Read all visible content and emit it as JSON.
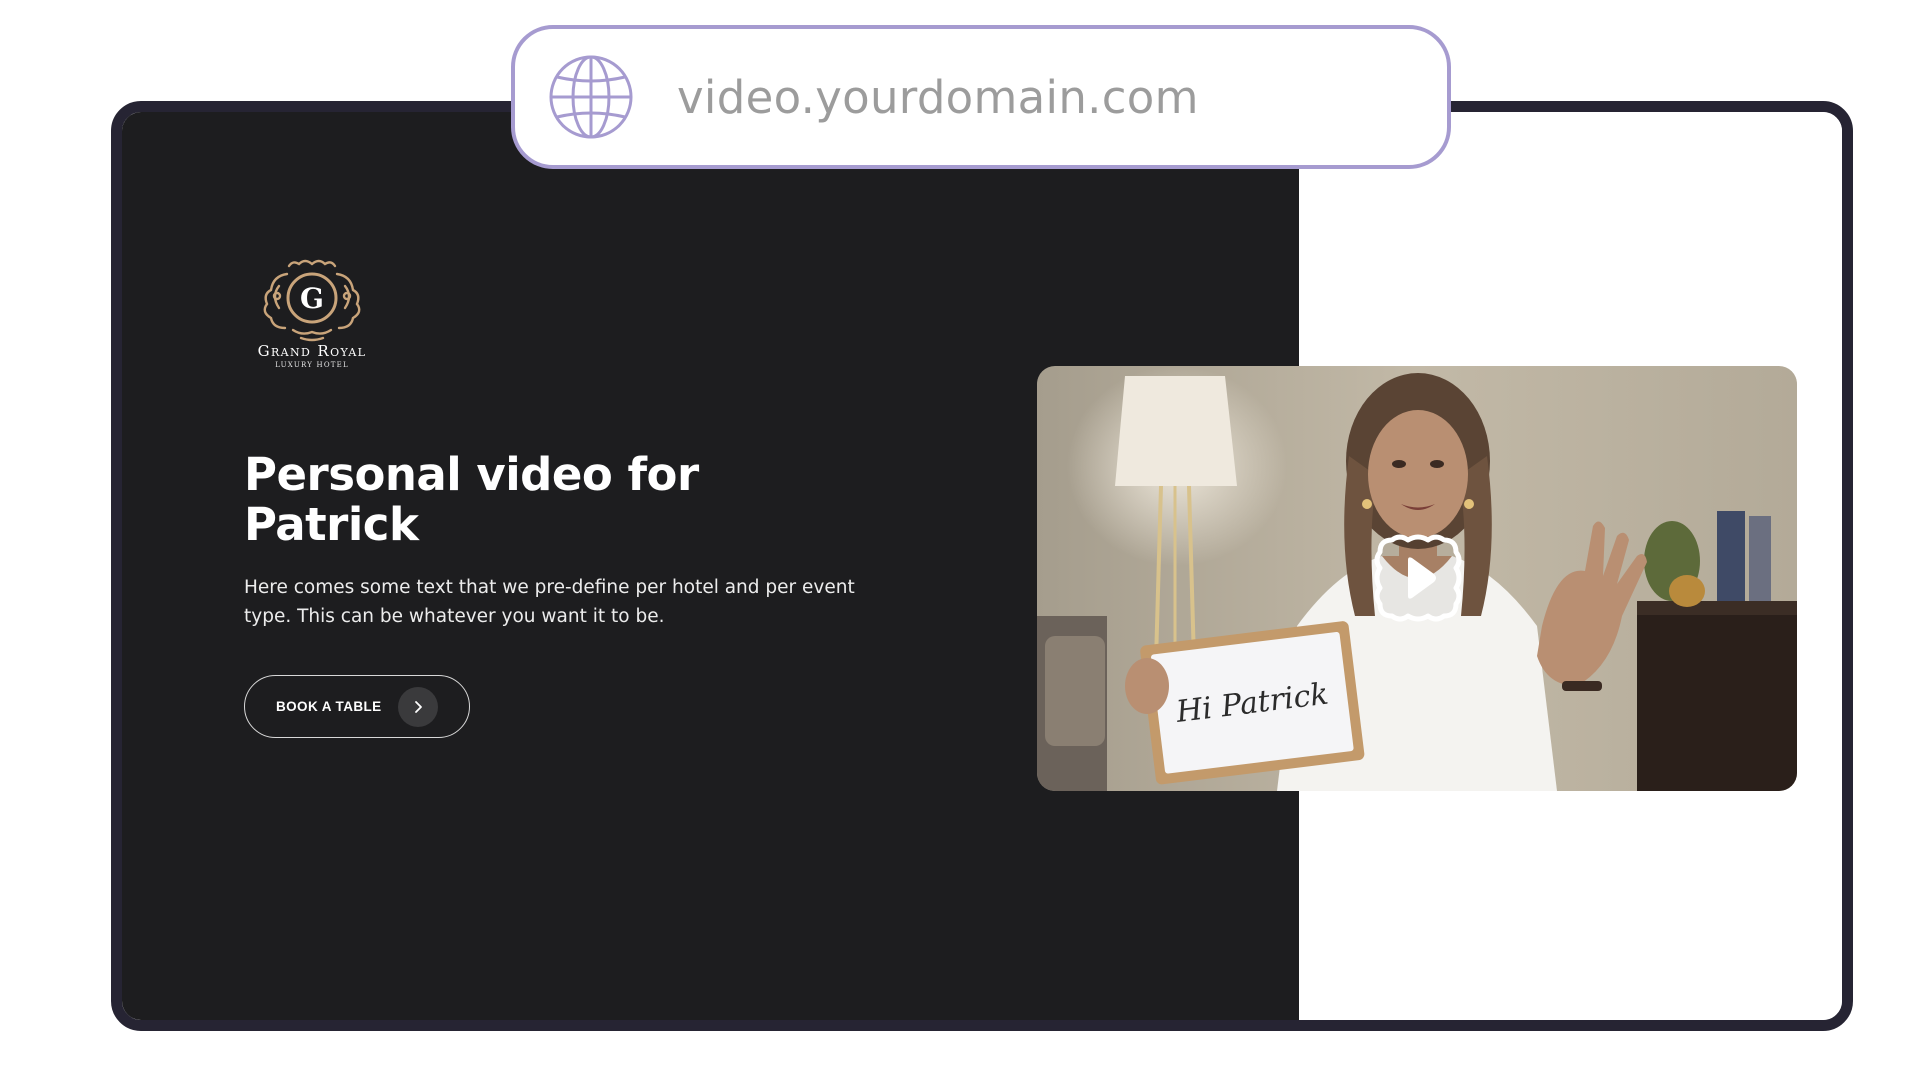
{
  "browser": {
    "url": "video.yourdomain.com",
    "url_icon": "globe-icon"
  },
  "hotel": {
    "logo_letter": "G",
    "name": "Grand Royal",
    "subtitle": "LUXURY HOTEL",
    "brand_color": "#c9a47a"
  },
  "hero": {
    "title_line1": "Personal video for",
    "title_line2": "Patrick",
    "description": "Here comes some text that we pre-define per hotel and per event type. This can be whatever you want it to be.",
    "cta_label": "BOOK A TABLE",
    "cta_icon": "chevron-right-icon"
  },
  "video": {
    "sign_text": "Hi Patrick",
    "play_icon": "play-icon"
  },
  "colors": {
    "dark_panel": "#1d1d1f",
    "frame": "#262433",
    "url_border": "#a69bd0",
    "url_text": "#9c9c9c"
  }
}
